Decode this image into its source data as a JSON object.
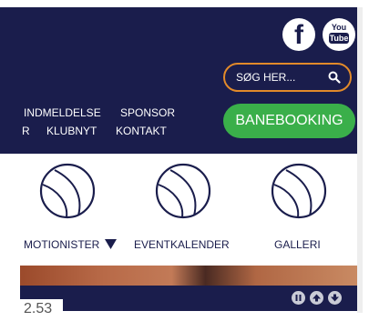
{
  "social": {
    "facebook_glyph": "f",
    "youtube_top": "You",
    "youtube_bottom": "Tube"
  },
  "search": {
    "placeholder": "SØG HER..."
  },
  "booking": {
    "label": "BANEBOOKING"
  },
  "nav": {
    "row1": [
      "INDMELDELSE",
      "SPONSOR"
    ],
    "row2": [
      "R",
      "KLUBNYT",
      "KONTAKT"
    ]
  },
  "icons": [
    {
      "label": "MOTIONISTER",
      "has_dropdown": true
    },
    {
      "label": "EVENTKALENDER",
      "has_dropdown": false
    },
    {
      "label": "GALLERI",
      "has_dropdown": false
    }
  ],
  "slider": {
    "counter": "2.53"
  },
  "colors": {
    "navy": "#1a1d4c",
    "green": "#3aaf4a",
    "orange": "#e28a2a"
  }
}
